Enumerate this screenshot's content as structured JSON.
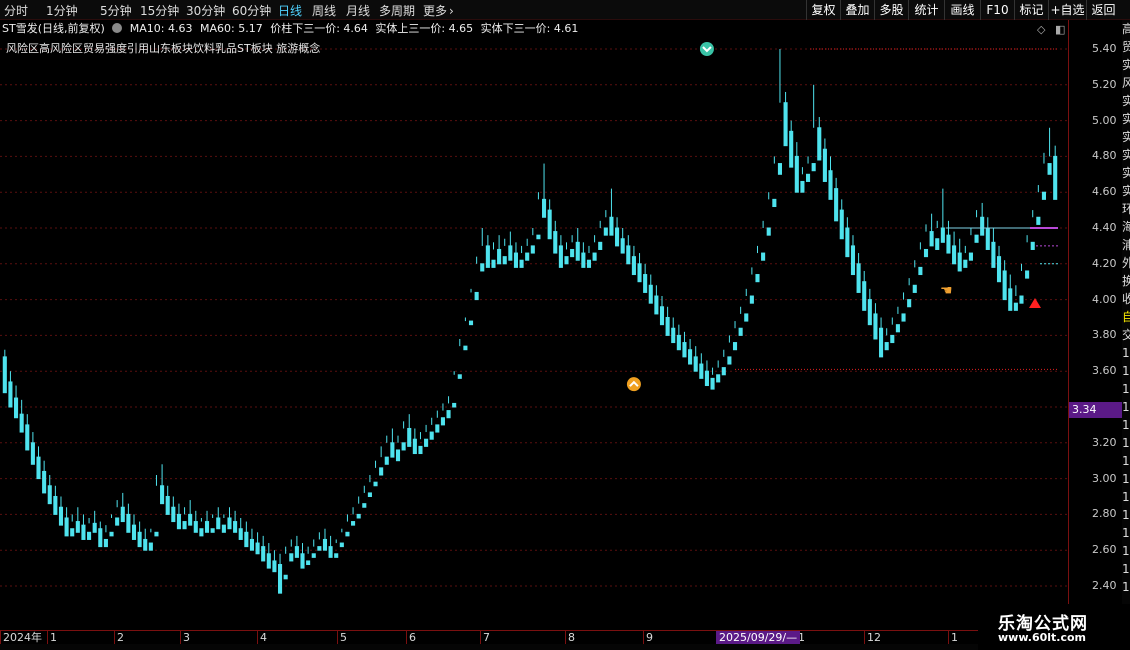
{
  "toolbar": {
    "timeframes": [
      {
        "label": "分时",
        "active": false
      },
      {
        "label": "1分钟",
        "active": false
      },
      {
        "label": "5分钟",
        "active": false
      },
      {
        "label": "15分钟",
        "active": false
      },
      {
        "label": "30分钟",
        "active": false
      },
      {
        "label": "60分钟",
        "active": false
      },
      {
        "label": "日线",
        "active": true
      },
      {
        "label": "周线",
        "active": false
      },
      {
        "label": "月线",
        "active": false
      },
      {
        "label": "多周期",
        "active": false
      },
      {
        "label": "更多",
        "active": false
      }
    ],
    "more_icon": "chevron-right-icon",
    "buttons": [
      "复权",
      "叠加",
      "多股",
      "统计",
      "画线",
      "F10",
      "标记",
      "+自选",
      "返回"
    ]
  },
  "info_bar": {
    "title": "ST雪发(日线,前复权)",
    "settings_icon": "settings-circle-icon",
    "ma10": "MA10: 4.63",
    "ma60": "MA60: 5.17",
    "indicator1": "价柱下三一价: 4.64",
    "indicator2": "实体上三一价: 4.65",
    "indicator3": "实体下三一价: 4.61"
  },
  "sectors": "风险区高风险区贸易强度引用山东板块饮料乳品ST板块 旅游概念",
  "corner_icons": [
    "diamond-icon",
    "window-toggle-icon"
  ],
  "y_axis": {
    "labels": [
      "5.40",
      "5.20",
      "5.00",
      "4.80",
      "4.60",
      "4.40",
      "4.20",
      "4.00",
      "3.80",
      "3.60",
      "3.40",
      "3.20",
      "3.00",
      "2.80",
      "2.60",
      "2.40"
    ],
    "current_price": "3.34"
  },
  "x_axis": {
    "labels": [
      "2024年",
      "1",
      "2",
      "3",
      "4",
      "5",
      "6",
      "7",
      "8",
      "9",
      "1",
      "12",
      "1"
    ],
    "cursor_date": "2025/09/29/—"
  },
  "side_strip_glyphs": [
    "高",
    "贸",
    "实",
    "风",
    "实",
    "实",
    "实",
    "实",
    "实",
    "实",
    "环",
    "海",
    "浦",
    "外",
    "换",
    "收",
    "自",
    "交",
    "1",
    "1",
    "1",
    "1",
    "1",
    "1",
    "1",
    "1",
    "1",
    "1",
    "1",
    "1",
    "1",
    "1"
  ],
  "watermark": {
    "title": "乐淘公式网",
    "url": "www.60lt.com"
  },
  "colors": {
    "up": "#ff3a3a",
    "down": "#4fe3ee",
    "highlight": "#f4ee00",
    "ma_line": "#b84ad8",
    "axis": "#7a1010",
    "active_tab": "#4fd2ff",
    "date_tag_bg": "#5b1a87"
  },
  "chart_data": {
    "type": "candlestick",
    "title": "ST雪发(日线,前复权)",
    "xlabel": "",
    "ylabel": "",
    "ylim": [
      2.32,
      5.52
    ],
    "grid": true,
    "y_ticks": [
      5.4,
      5.2,
      5.0,
      4.8,
      4.6,
      4.4,
      4.2,
      4.0,
      3.8,
      3.6,
      3.4,
      3.2,
      3.0,
      2.8,
      2.6,
      2.4
    ],
    "reference_lines": {
      "high_marker": 5.4,
      "low_marker": 3.61
    },
    "ma_levels": {
      "MA10": 4.63,
      "MA60": 5.17
    },
    "markers": [
      {
        "type": "top-signal",
        "value": 5.4,
        "bar": 125
      },
      {
        "type": "bottom-signal",
        "value": 3.55,
        "bar": 112
      }
    ],
    "bars": [
      [
        3.68,
        3.72,
        3.55,
        3.48
      ],
      [
        3.54,
        3.6,
        3.45,
        3.4
      ],
      [
        3.45,
        3.52,
        3.38,
        3.34
      ],
      [
        3.36,
        3.44,
        3.3,
        3.26
      ],
      [
        3.3,
        3.36,
        3.2,
        3.16
      ],
      [
        3.2,
        3.26,
        3.12,
        3.08
      ],
      [
        3.12,
        3.18,
        3.04,
        3.0
      ],
      [
        3.04,
        3.1,
        2.96,
        2.92
      ],
      [
        2.96,
        3.02,
        2.9,
        2.86
      ],
      [
        2.9,
        2.96,
        2.84,
        2.8
      ],
      [
        2.84,
        2.9,
        2.78,
        2.74
      ],
      [
        2.78,
        2.84,
        2.72,
        2.68
      ],
      [
        2.72,
        2.8,
        2.76,
        2.68
      ],
      [
        2.76,
        2.84,
        2.74,
        2.7
      ],
      [
        2.74,
        2.8,
        2.7,
        2.66
      ],
      [
        2.7,
        2.78,
        2.75,
        2.66
      ],
      [
        2.75,
        2.82,
        2.72,
        2.7
      ],
      [
        2.72,
        2.76,
        2.66,
        2.62
      ],
      [
        2.66,
        2.74,
        2.7,
        2.62
      ],
      [
        2.7,
        2.8,
        2.78,
        2.68
      ],
      [
        2.78,
        2.88,
        2.84,
        2.74
      ],
      [
        2.84,
        2.92,
        2.8,
        2.76
      ],
      [
        2.8,
        2.86,
        2.74,
        2.7
      ],
      [
        2.74,
        2.8,
        2.7,
        2.66
      ],
      [
        2.7,
        2.76,
        2.66,
        2.62
      ],
      [
        2.66,
        2.72,
        2.64,
        2.6
      ],
      [
        2.64,
        2.72,
        2.7,
        2.6
      ],
      [
        2.7,
        3.02,
        2.96,
        2.68
      ],
      [
        2.96,
        3.08,
        2.9,
        2.86
      ],
      [
        2.9,
        2.96,
        2.84,
        2.8
      ],
      [
        2.84,
        2.9,
        2.8,
        2.76
      ],
      [
        2.8,
        2.86,
        2.76,
        2.72
      ],
      [
        2.76,
        2.84,
        2.8,
        2.72
      ],
      [
        2.8,
        2.88,
        2.76,
        2.74
      ],
      [
        2.76,
        2.82,
        2.72,
        2.7
      ],
      [
        2.72,
        2.78,
        2.76,
        2.68
      ],
      [
        2.76,
        2.82,
        2.72,
        2.7
      ],
      [
        2.72,
        2.8,
        2.78,
        2.7
      ],
      [
        2.78,
        2.84,
        2.74,
        2.72
      ],
      [
        2.74,
        2.8,
        2.78,
        2.7
      ],
      [
        2.78,
        2.84,
        2.76,
        2.72
      ],
      [
        2.76,
        2.82,
        2.72,
        2.7
      ],
      [
        2.72,
        2.78,
        2.7,
        2.66
      ],
      [
        2.7,
        2.76,
        2.66,
        2.62
      ],
      [
        2.66,
        2.72,
        2.64,
        2.6
      ],
      [
        2.64,
        2.7,
        2.62,
        2.58
      ],
      [
        2.62,
        2.68,
        2.58,
        2.54
      ],
      [
        2.58,
        2.64,
        2.54,
        2.5
      ],
      [
        2.54,
        2.6,
        2.52,
        2.48
      ],
      [
        2.52,
        2.58,
        2.46,
        2.36
      ],
      [
        2.46,
        2.62,
        2.58,
        2.44
      ],
      [
        2.58,
        2.66,
        2.62,
        2.54
      ],
      [
        2.62,
        2.68,
        2.58,
        2.56
      ],
      [
        2.58,
        2.64,
        2.54,
        2.5
      ],
      [
        2.54,
        2.62,
        2.58,
        2.52
      ],
      [
        2.58,
        2.66,
        2.62,
        2.56
      ],
      [
        2.62,
        2.7,
        2.66,
        2.6
      ],
      [
        2.66,
        2.72,
        2.62,
        2.6
      ],
      [
        2.62,
        2.68,
        2.58,
        2.56
      ],
      [
        2.58,
        2.66,
        2.64,
        2.56
      ],
      [
        2.64,
        2.72,
        2.7,
        2.62
      ],
      [
        2.7,
        2.8,
        2.76,
        2.68
      ],
      [
        2.76,
        2.84,
        2.8,
        2.74
      ],
      [
        2.8,
        2.9,
        2.86,
        2.78
      ],
      [
        2.86,
        2.96,
        2.92,
        2.84
      ],
      [
        2.92,
        3.02,
        2.98,
        2.9
      ],
      [
        2.98,
        3.1,
        3.06,
        2.96
      ],
      [
        3.06,
        3.18,
        3.12,
        3.02
      ],
      [
        3.12,
        3.24,
        3.2,
        3.08
      ],
      [
        3.2,
        3.28,
        3.16,
        3.12
      ],
      [
        3.16,
        3.24,
        3.2,
        3.1
      ],
      [
        3.2,
        3.32,
        3.28,
        3.16
      ],
      [
        3.28,
        3.36,
        3.22,
        3.18
      ],
      [
        3.22,
        3.28,
        3.18,
        3.14
      ],
      [
        3.18,
        3.26,
        3.22,
        3.14
      ],
      [
        3.22,
        3.3,
        3.26,
        3.18
      ],
      [
        3.26,
        3.34,
        3.3,
        3.22
      ],
      [
        3.3,
        3.38,
        3.34,
        3.26
      ],
      [
        3.34,
        3.42,
        3.38,
        3.3
      ],
      [
        3.38,
        3.46,
        3.42,
        3.34
      ],
      [
        3.42,
        3.6,
        3.58,
        3.4
      ],
      [
        3.58,
        3.78,
        3.74,
        3.56
      ],
      [
        3.74,
        3.9,
        3.88,
        3.72
      ],
      [
        3.88,
        4.06,
        4.04,
        3.86
      ],
      [
        4.04,
        4.24,
        4.2,
        4.0
      ],
      [
        4.2,
        4.4,
        4.3,
        4.16
      ],
      [
        4.3,
        4.36,
        4.22,
        4.18
      ],
      [
        4.22,
        4.32,
        4.28,
        4.18
      ],
      [
        4.28,
        4.36,
        4.24,
        4.2
      ],
      [
        4.24,
        4.34,
        4.3,
        4.2
      ],
      [
        4.3,
        4.38,
        4.26,
        4.22
      ],
      [
        4.26,
        4.32,
        4.22,
        4.18
      ],
      [
        4.22,
        4.3,
        4.26,
        4.18
      ],
      [
        4.26,
        4.34,
        4.3,
        4.22
      ],
      [
        4.3,
        4.4,
        4.36,
        4.26
      ],
      [
        4.36,
        4.6,
        4.56,
        4.34
      ],
      [
        4.56,
        4.76,
        4.5,
        4.46
      ],
      [
        4.5,
        4.56,
        4.38,
        4.34
      ],
      [
        4.38,
        4.44,
        4.3,
        4.26
      ],
      [
        4.3,
        4.36,
        4.24,
        4.18
      ],
      [
        4.24,
        4.32,
        4.28,
        4.2
      ],
      [
        4.28,
        4.36,
        4.32,
        4.24
      ],
      [
        4.32,
        4.4,
        4.26,
        4.22
      ],
      [
        4.26,
        4.32,
        4.22,
        4.18
      ],
      [
        4.22,
        4.3,
        4.26,
        4.18
      ],
      [
        4.26,
        4.36,
        4.32,
        4.22
      ],
      [
        4.32,
        4.44,
        4.4,
        4.28
      ],
      [
        4.4,
        4.5,
        4.46,
        4.36
      ],
      [
        4.46,
        4.62,
        4.4,
        4.36
      ],
      [
        4.4,
        4.46,
        4.34,
        4.3
      ],
      [
        4.34,
        4.4,
        4.3,
        4.26
      ],
      [
        4.3,
        4.36,
        4.24,
        4.2
      ],
      [
        4.24,
        4.3,
        4.2,
        4.14
      ],
      [
        4.2,
        4.26,
        4.14,
        4.1
      ],
      [
        4.14,
        4.2,
        4.08,
        4.04
      ],
      [
        4.08,
        4.14,
        4.02,
        3.98
      ],
      [
        4.02,
        4.08,
        3.96,
        3.92
      ],
      [
        3.96,
        4.02,
        3.9,
        3.86
      ],
      [
        3.9,
        3.96,
        3.84,
        3.8
      ],
      [
        3.84,
        3.9,
        3.8,
        3.76
      ],
      [
        3.8,
        3.86,
        3.76,
        3.72
      ],
      [
        3.76,
        3.82,
        3.72,
        3.68
      ],
      [
        3.72,
        3.78,
        3.68,
        3.64
      ],
      [
        3.68,
        3.74,
        3.64,
        3.6
      ],
      [
        3.64,
        3.7,
        3.6,
        3.56
      ],
      [
        3.6,
        3.66,
        3.56,
        3.52
      ],
      [
        3.56,
        3.62,
        3.58,
        3.5
      ],
      [
        3.58,
        3.66,
        3.62,
        3.54
      ],
      [
        3.62,
        3.72,
        3.68,
        3.58
      ],
      [
        3.68,
        3.8,
        3.76,
        3.64
      ],
      [
        3.76,
        3.88,
        3.84,
        3.72
      ],
      [
        3.84,
        3.96,
        3.92,
        3.8
      ],
      [
        3.92,
        4.06,
        4.02,
        3.88
      ],
      [
        4.02,
        4.18,
        4.14,
        3.98
      ],
      [
        4.14,
        4.3,
        4.26,
        4.1
      ],
      [
        4.26,
        4.44,
        4.4,
        4.22
      ],
      [
        4.4,
        4.6,
        4.56,
        4.36
      ],
      [
        4.56,
        4.8,
        4.76,
        4.52
      ],
      [
        4.76,
        5.4,
        5.1,
        4.7
      ],
      [
        5.1,
        5.16,
        4.94,
        4.86
      ],
      [
        4.94,
        5.0,
        4.8,
        4.74
      ],
      [
        4.8,
        4.88,
        4.66,
        4.6
      ],
      [
        4.66,
        4.74,
        4.7,
        4.6
      ],
      [
        4.7,
        4.8,
        4.76,
        4.66
      ],
      [
        4.76,
        5.2,
        4.96,
        4.72
      ],
      [
        4.96,
        5.02,
        4.84,
        4.78
      ],
      [
        4.84,
        4.9,
        4.72,
        4.66
      ],
      [
        4.72,
        4.8,
        4.62,
        4.56
      ],
      [
        4.62,
        4.68,
        4.5,
        4.44
      ],
      [
        4.5,
        4.56,
        4.4,
        4.34
      ],
      [
        4.4,
        4.46,
        4.3,
        4.24
      ],
      [
        4.3,
        4.36,
        4.2,
        4.14
      ],
      [
        4.2,
        4.26,
        4.1,
        4.04
      ],
      [
        4.1,
        4.16,
        4.0,
        3.94
      ],
      [
        4.0,
        4.06,
        3.92,
        3.86
      ],
      [
        3.92,
        3.98,
        3.84,
        3.78
      ],
      [
        3.84,
        3.9,
        3.76,
        3.68
      ],
      [
        3.76,
        3.84,
        3.8,
        3.72
      ],
      [
        3.8,
        3.9,
        3.86,
        3.76
      ],
      [
        3.86,
        3.96,
        3.92,
        3.82
      ],
      [
        3.92,
        4.04,
        4.0,
        3.88
      ],
      [
        4.0,
        4.12,
        4.08,
        3.96
      ],
      [
        4.08,
        4.22,
        4.18,
        4.04
      ],
      [
        4.18,
        4.32,
        4.28,
        4.14
      ],
      [
        4.28,
        4.42,
        4.38,
        4.24
      ],
      [
        4.38,
        4.48,
        4.34,
        4.3
      ],
      [
        4.34,
        4.44,
        4.4,
        4.28
      ],
      [
        4.4,
        4.62,
        4.36,
        4.32
      ],
      [
        4.36,
        4.44,
        4.3,
        4.26
      ],
      [
        4.3,
        4.38,
        4.26,
        4.2
      ],
      [
        4.26,
        4.34,
        4.22,
        4.16
      ],
      [
        4.22,
        4.3,
        4.26,
        4.18
      ],
      [
        4.26,
        4.4,
        4.36,
        4.22
      ],
      [
        4.36,
        4.5,
        4.46,
        4.32
      ],
      [
        4.46,
        4.54,
        4.4,
        4.36
      ],
      [
        4.4,
        4.46,
        4.32,
        4.28
      ],
      [
        4.32,
        4.4,
        4.24,
        4.18
      ],
      [
        4.24,
        4.3,
        4.16,
        4.1
      ],
      [
        4.16,
        4.22,
        4.06,
        4.0
      ],
      [
        4.06,
        4.14,
        3.98,
        3.94
      ],
      [
        3.98,
        4.08,
        4.02,
        3.94
      ],
      [
        4.02,
        4.2,
        4.16,
        3.98
      ],
      [
        4.16,
        4.36,
        4.32,
        4.12
      ],
      [
        4.32,
        4.5,
        4.46,
        4.28
      ],
      [
        4.46,
        4.64,
        4.6,
        4.42
      ],
      [
        4.6,
        4.82,
        4.76,
        4.56
      ],
      [
        4.76,
        4.96,
        4.8,
        4.7
      ],
      [
        4.8,
        4.86,
        4.6,
        4.56
      ]
    ]
  }
}
